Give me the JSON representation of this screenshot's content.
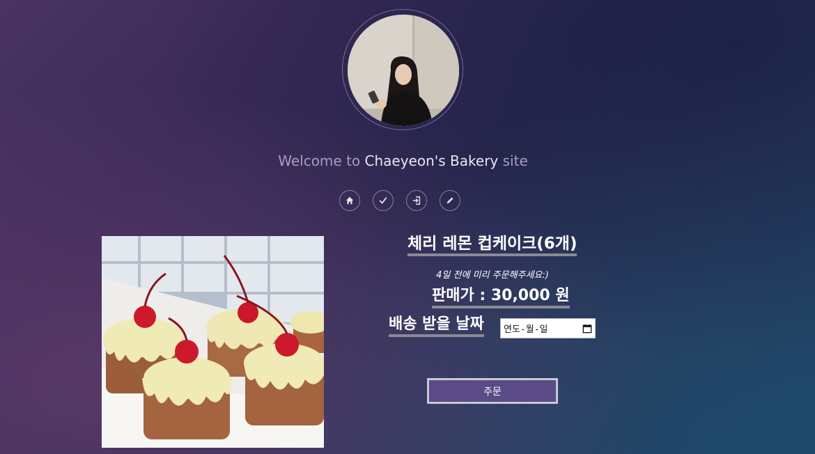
{
  "welcome": {
    "prefix": "Welcome to",
    "brand": "Chaeyeon's Bakery",
    "suffix": "site"
  },
  "nav": [
    {
      "icon": "home-icon"
    },
    {
      "icon": "check-icon"
    },
    {
      "icon": "sign-in-icon"
    },
    {
      "icon": "pencil-icon"
    }
  ],
  "product": {
    "title": "체리 레몬 컵케이크(6개)",
    "notice": "4일 전에 미리 주문해주세요:)",
    "price": "판매가 : 30,000 원",
    "delivery_label": "배송 받을 날짜",
    "date_placeholder": "연도-월-일",
    "order_label": "주문"
  },
  "colors": {
    "accent": "#5a4a86",
    "welcome_muted": "#a89cbf",
    "underline": "#8a8a95"
  }
}
